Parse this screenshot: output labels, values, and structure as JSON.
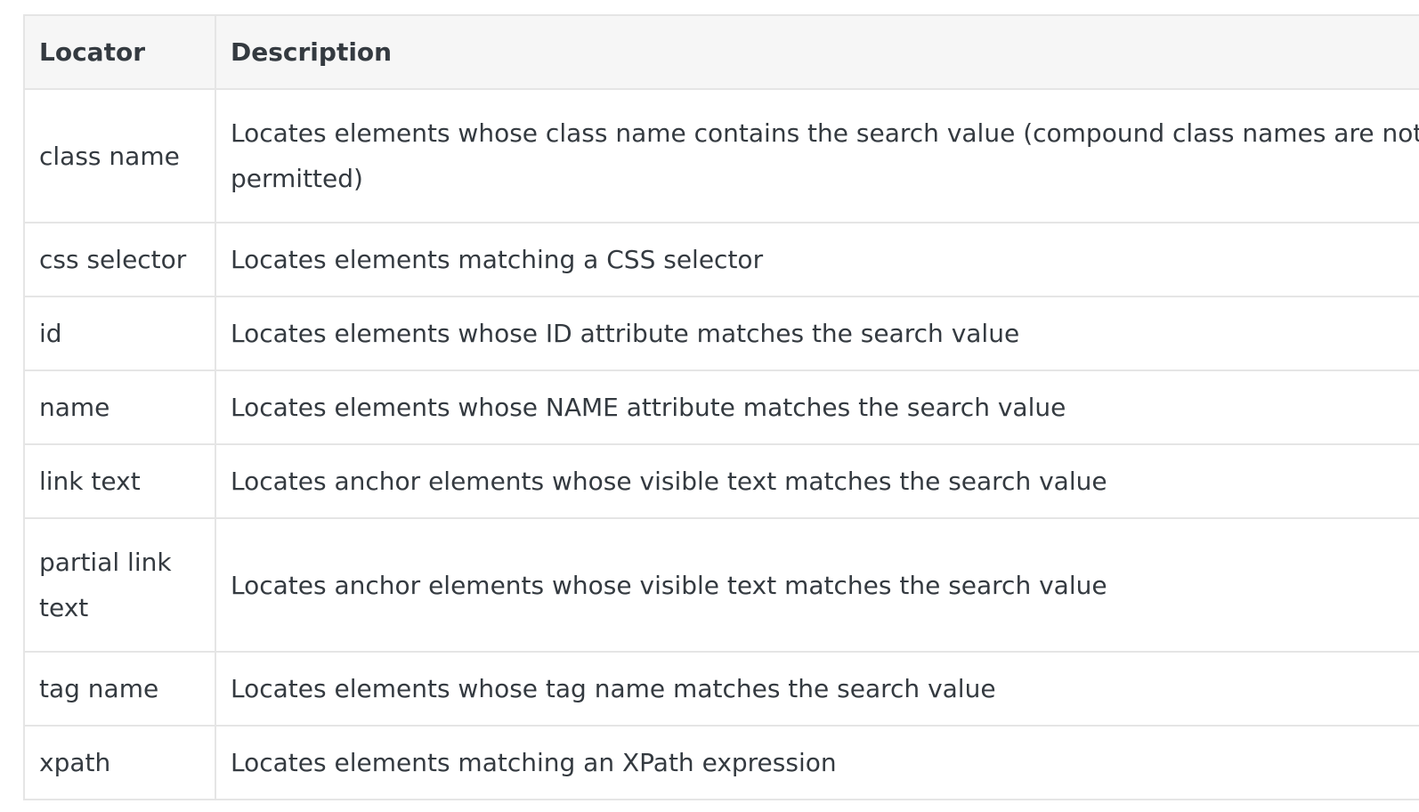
{
  "table": {
    "headers": {
      "locator": "Locator",
      "description": "Description"
    },
    "rows": [
      {
        "locator": "class name",
        "description": "Locates elements whose class name contains the search value (compound class names are not permitted)"
      },
      {
        "locator": "css selector",
        "description": "Locates elements matching a CSS selector"
      },
      {
        "locator": "id",
        "description": "Locates elements whose ID attribute matches the search value"
      },
      {
        "locator": "name",
        "description": "Locates elements whose NAME attribute matches the search value"
      },
      {
        "locator": "link text",
        "description": "Locates anchor elements whose visible text matches the search value"
      },
      {
        "locator": "partial link text",
        "description": "Locates anchor elements whose visible text matches the search value"
      },
      {
        "locator": "tag name",
        "description": "Locates elements whose tag name matches the search value"
      },
      {
        "locator": "xpath",
        "description": "Locates elements matching an XPath expression"
      }
    ]
  }
}
